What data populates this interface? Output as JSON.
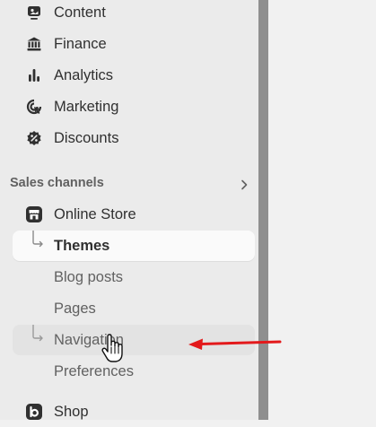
{
  "nav": {
    "content": {
      "label": "Content",
      "icon": "content-icon"
    },
    "finance": {
      "label": "Finance",
      "icon": "bank-icon"
    },
    "analytics": {
      "label": "Analytics",
      "icon": "bar-chart-icon"
    },
    "marketing": {
      "label": "Marketing",
      "icon": "target-icon"
    },
    "discounts": {
      "label": "Discounts",
      "icon": "discount-badge-icon"
    }
  },
  "sales_channels": {
    "heading": "Sales channels",
    "chevron": "chevron-right-icon",
    "online_store": {
      "label": "Online Store",
      "icon": "storefront-icon",
      "children": {
        "themes": {
          "label": "Themes",
          "state": "active"
        },
        "blog_posts": {
          "label": "Blog posts"
        },
        "pages": {
          "label": "Pages"
        },
        "navigation": {
          "label": "Navigation",
          "state": "hover"
        },
        "preferences": {
          "label": "Preferences"
        }
      }
    },
    "shop": {
      "label": "Shop",
      "icon": "shop-app-icon"
    }
  },
  "annotation": {
    "arrow_color": "#e3191b",
    "cursor": "hand-pointer-icon"
  },
  "colors": {
    "sidebar_bg": "#ebebeb",
    "divider": "#8f8f8f",
    "active_bg": "#fafafa"
  }
}
